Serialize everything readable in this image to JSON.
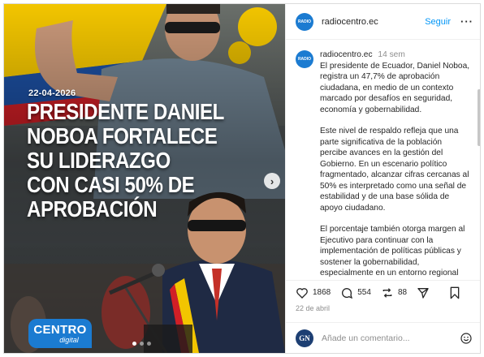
{
  "post": {
    "media": {
      "date_overlay": "22-04-2026",
      "headline_lines": [
        "PRESIDENTE DANIEL",
        "NOBOA FORTALECE",
        "SU LIDERAZGO",
        "CON CASI 50% DE",
        "APROBACIÓN"
      ],
      "logo_line1": "CENTRO",
      "logo_line2": "digital",
      "carousel_dots": 3,
      "carousel_active": 0,
      "next_arrow_icon": "chevron-right-icon",
      "colors": {
        "logo_blue": "#1b7bd1",
        "flag_yellow": "#f2c500",
        "flag_blue": "#1c4fa1",
        "flag_red": "#d11f26"
      }
    },
    "header": {
      "username": "radiocentro.ec",
      "separator": "•",
      "follow_label": "Seguir",
      "more_icon": "more-horizontal-icon"
    },
    "caption": {
      "username": "radiocentro.ec",
      "time": "14 sem",
      "paragraphs": [
        "El presidente de Ecuador, Daniel Noboa, registra un 47,7% de aprobación ciudadana, en medio de un contexto marcado por desafíos en seguridad, economía y gobernabilidad.",
        "Este nivel de respaldo refleja que una parte significativa de la población percibe avances en la gestión del Gobierno. En un escenario político fragmentado, alcanzar cifras cercanas al 50% es interpretado como una señal de estabilidad y de una base sólida de apoyo ciudadano.",
        "El porcentaje también otorga margen al Ejecutivo para continuar con la implementación de políticas públicas y sostener la gobernabilidad, especialmente en un entorno regional donde pocos mandatarios logran"
      ]
    },
    "actions": {
      "likes": "1868",
      "comments": "554",
      "reposts": "88",
      "icons": [
        "heart-icon",
        "comment-icon",
        "repost-icon",
        "share-icon",
        "bookmark-icon"
      ]
    },
    "date": "22 de abril",
    "comment_box": {
      "avatar_text": "GN",
      "placeholder": "Añade un comentario...",
      "emoji_icon": "emoji-icon"
    }
  }
}
